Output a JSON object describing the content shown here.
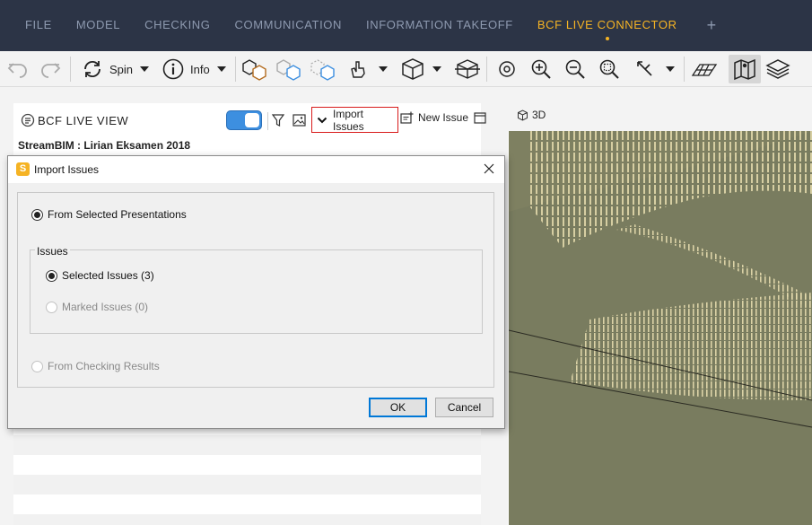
{
  "menu": {
    "items": [
      "FILE",
      "MODEL",
      "CHECKING",
      "COMMUNICATION",
      "INFORMATION TAKEOFF",
      "BCF LIVE CONNECTOR"
    ],
    "active_index": 5,
    "add_tab": "+"
  },
  "toolbar": {
    "spin_label": "Spin",
    "info_label": "Info"
  },
  "bcf": {
    "title": "BCF LIVE VIEW",
    "import_issues_label": "Import Issues",
    "new_issue_label": "New Issue",
    "project_name": "StreamBIM : Lirian Eksamen 2018",
    "live_toggle_on": true
  },
  "view3d": {
    "tab_label": "3D"
  },
  "dialog": {
    "title": "Import Issues",
    "icon_letter": "S",
    "from_selected_presentations": "From Selected Presentations",
    "issues_group_label": "Issues",
    "selected_issues": "Selected Issues (3)",
    "marked_issues": "Marked Issues (0)",
    "from_checking_results": "From Checking Results",
    "ok_label": "OK",
    "cancel_label": "Cancel"
  },
  "colors": {
    "menubar_bg": "#2c3446",
    "menu_text": "#8e9ab0",
    "menu_active": "#f5b324",
    "toggle_blue": "#3d8fe0",
    "highlight_red": "#d81b1b",
    "view_bg": "#797c5f",
    "stripe": "#e6dcae"
  }
}
